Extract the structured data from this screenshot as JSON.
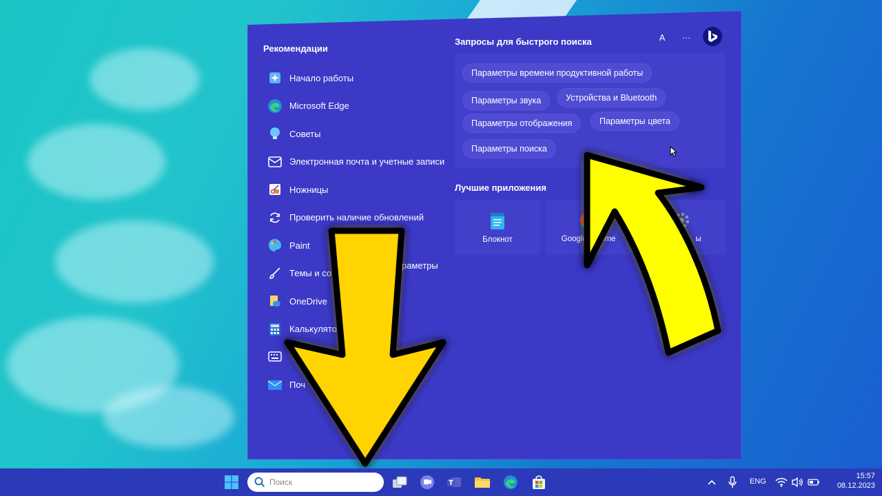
{
  "recommendations": {
    "title": "Рекомендации",
    "items": [
      {
        "label": "Начало работы",
        "icon": "get-started-icon"
      },
      {
        "label": "Microsoft Edge",
        "icon": "edge-icon"
      },
      {
        "label": "Советы",
        "icon": "tips-icon"
      },
      {
        "label": "Электронная почта и учетные записи",
        "icon": "mail-outline-icon"
      },
      {
        "label": "Ножницы",
        "icon": "snipping-tool-icon"
      },
      {
        "label": "Проверить наличие обновлений",
        "icon": "update-icon"
      },
      {
        "label": "Paint",
        "icon": "paint-icon"
      },
      {
        "label": "Темы и со",
        "icon": "brush-icon"
      },
      {
        "label": "OneDrive",
        "icon": "onedrive-icon"
      },
      {
        "label": "Калькулято",
        "icon": "calculator-icon"
      },
      {
        "label": "",
        "icon": "keyboard-icon"
      },
      {
        "label": "Поч",
        "icon": "mail-icon"
      }
    ],
    "partial_label": "раметры"
  },
  "quick_search": {
    "title": "Запросы для быстрого поиска",
    "chips": [
      "Параметры времени продуктивной работы",
      "Параметры звука",
      "Устройства и Bluetooth",
      "Параметры отображения",
      "Параметры цвета",
      "Параметры поиска"
    ]
  },
  "header": {
    "avatar_letter": "A",
    "more_label": "···"
  },
  "top_apps": {
    "title": "Лучшие приложения",
    "apps": [
      {
        "label": "Блокнот",
        "icon": "notepad-icon"
      },
      {
        "label": "Google",
        "icon": "chrome-icon"
      },
      {
        "label": "ome",
        "icon": ""
      },
      {
        "label": "ы",
        "icon": "settings-icon"
      }
    ]
  },
  "taskbar": {
    "search_placeholder": "Поиск",
    "language": "ENG",
    "time": "15:57",
    "date": "08.12.2023"
  },
  "colors": {
    "panel": "#3b39c6",
    "taskbar": "#2b3ab8",
    "arrow_down": "#ffd400",
    "arrow_up": "#ffff00"
  }
}
